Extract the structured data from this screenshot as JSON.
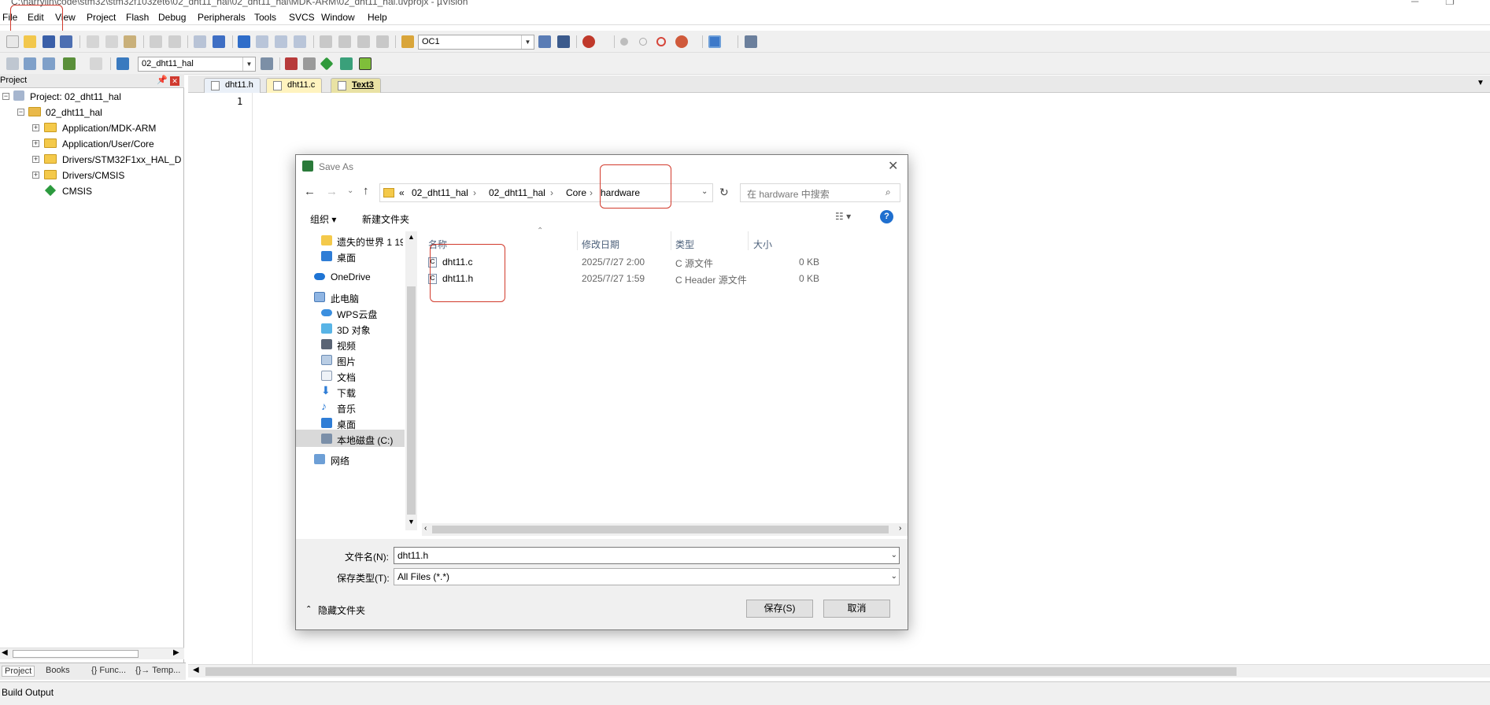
{
  "window": {
    "title": "C:\\harrylin\\code\\stm32\\stm32f103zet6\\02_dht11_hal\\02_dht11_hal\\MDK-ARM\\02_dht11_hal.uvprojx - µVision"
  },
  "menu": [
    "File",
    "Edit",
    "View",
    "Project",
    "Flash",
    "Debug",
    "Peripherals",
    "Tools",
    "SVCS",
    "Window",
    "Help"
  ],
  "toolbar": {
    "target_combo": "OC1",
    "build_target": "02_dht11_hal"
  },
  "project_panel": {
    "title": "Project",
    "root": "Project: 02_dht11_hal",
    "target": "02_dht11_hal",
    "groups": [
      "Application/MDK-ARM",
      "Application/User/Core",
      "Drivers/STM32F1xx_HAL_Driver",
      "Drivers/CMSIS"
    ],
    "cmsis": "CMSIS",
    "bottom_tabs": [
      "Project",
      "Books",
      "{} Func...",
      "{}→ Temp..."
    ]
  },
  "editor": {
    "tabs": [
      "dht11.h",
      "dht11.c",
      "Text3"
    ],
    "line_numbers": [
      "1"
    ]
  },
  "build_output": "Build Output",
  "dialog": {
    "title": "Save As",
    "breadcrumb": [
      "«",
      "02_dht11_hal",
      "02_dht11_hal",
      "Core",
      "hardware"
    ],
    "search_placeholder": "在 hardware 中搜索",
    "organize": "组织 ▾",
    "new_folder": "新建文件夹",
    "nav_items": [
      "遗失的世界 1 19",
      "桌面",
      "OneDrive",
      "此电脑",
      "WPS云盘",
      "3D 对象",
      "视频",
      "图片",
      "文档",
      "下载",
      "音乐",
      "桌面",
      "本地磁盘 (C:)",
      "网络"
    ],
    "columns": [
      "名称",
      "修改日期",
      "类型",
      "大小"
    ],
    "files": [
      {
        "name": "dht11.c",
        "date": "2025/7/27 2:00",
        "type": "C 源文件",
        "size": "0 KB"
      },
      {
        "name": "dht11.h",
        "date": "2025/7/27 1:59",
        "type": "C Header 源文件",
        "size": "0 KB"
      }
    ],
    "filename_label": "文件名(N):",
    "filename_value": "dht11.h",
    "filetype_label": "保存类型(T):",
    "filetype_value": "All Files (*.*)",
    "hide_folders": "隐藏文件夹",
    "save_button": "保存(S)",
    "cancel_button": "取消"
  },
  "annotation_color": "#d23a2c"
}
